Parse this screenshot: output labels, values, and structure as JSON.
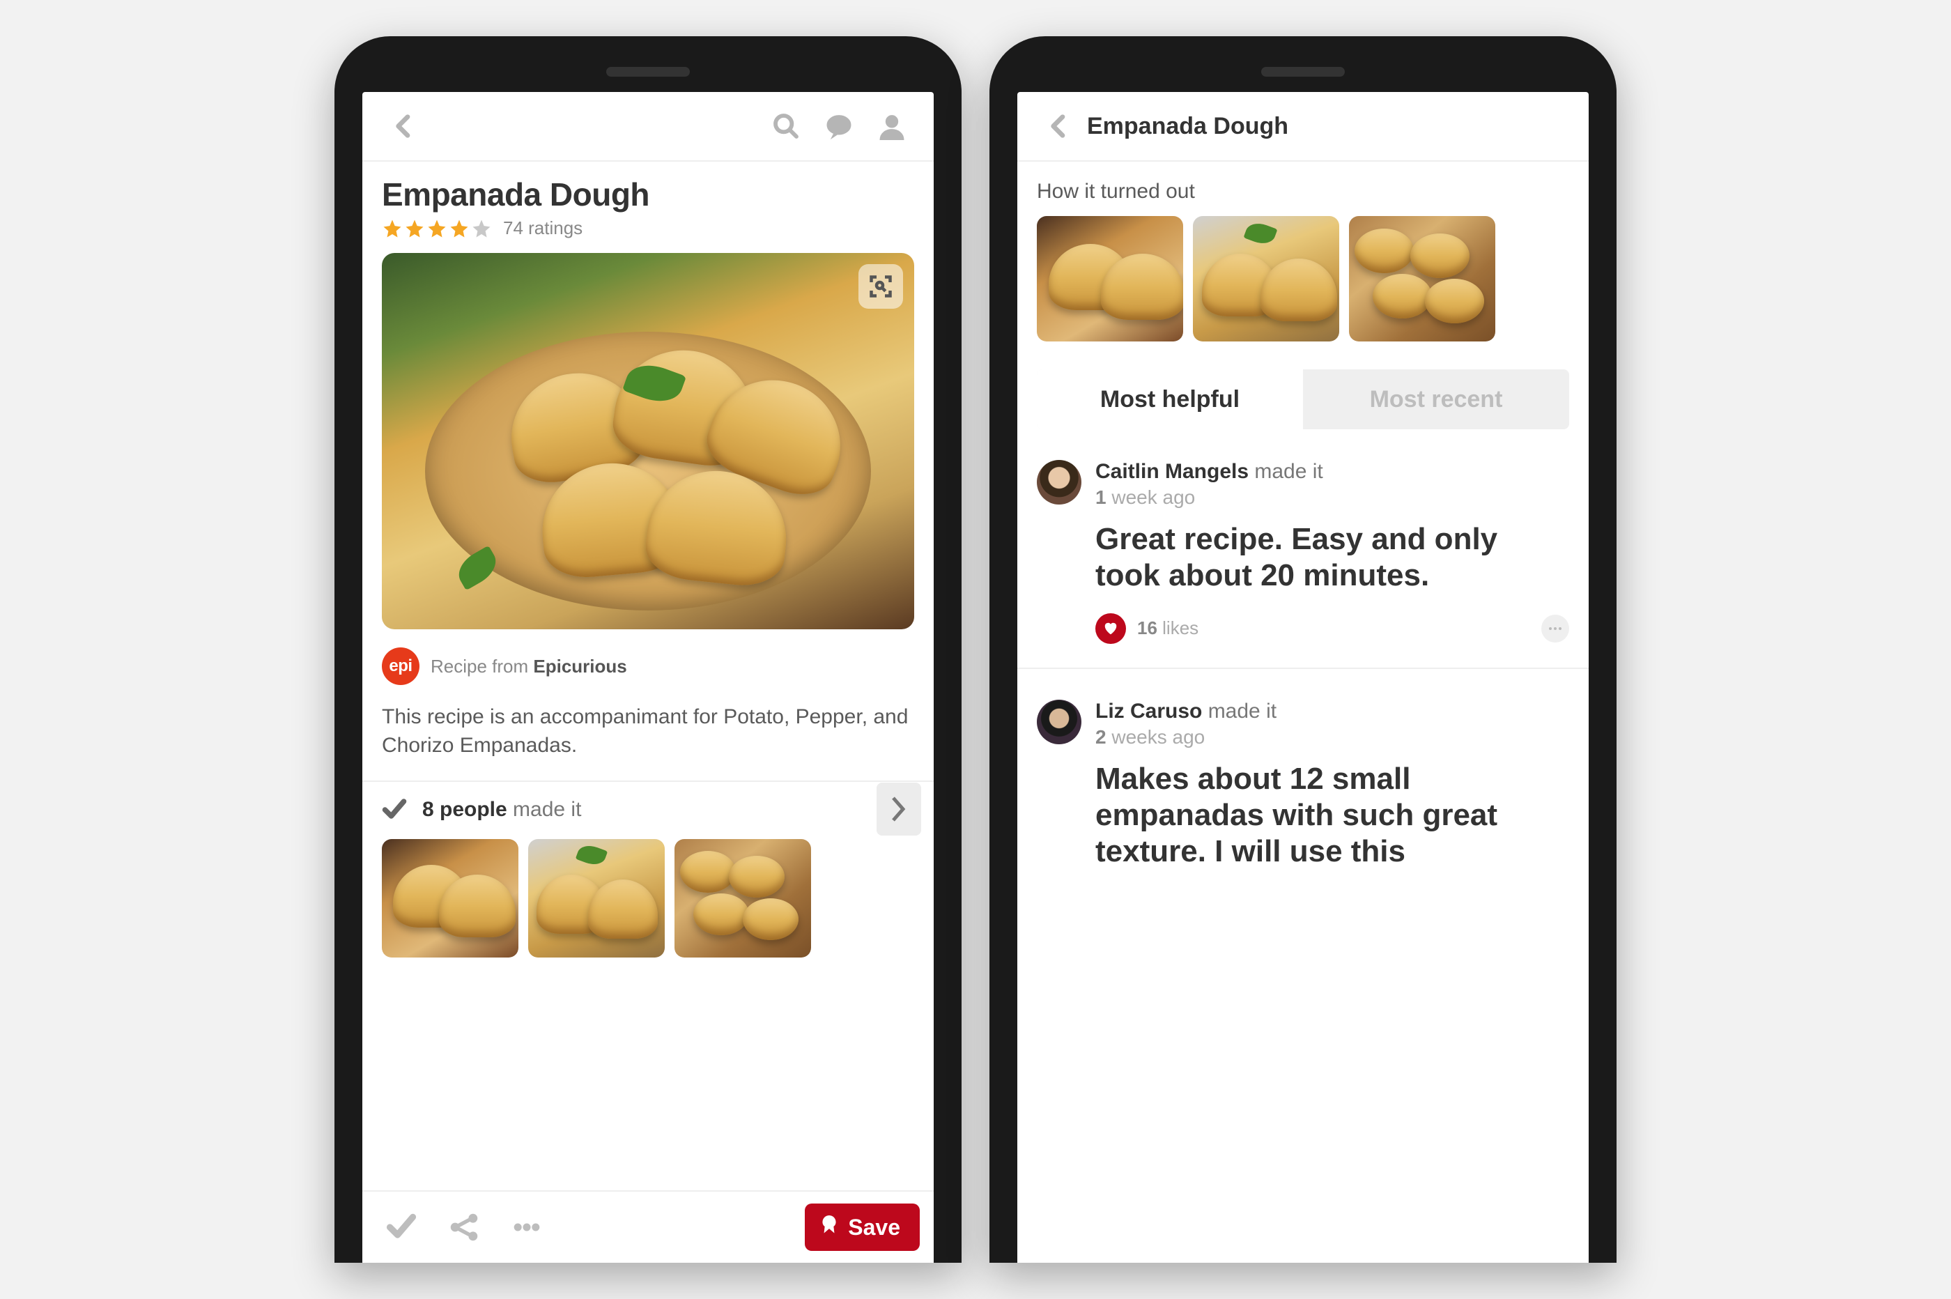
{
  "left": {
    "title": "Empanada Dough",
    "rating": {
      "stars": 4,
      "max": 5,
      "count_text": "74 ratings"
    },
    "source": {
      "badge": "epi",
      "prefix": "Recipe from ",
      "name": "Epicurious"
    },
    "description": "This recipe is an accompanimant for Potato, Pepper, and Chorizo Empanadas.",
    "made_it": {
      "count_bold": "8 people",
      "suffix": " made it"
    },
    "bottom": {
      "save_label": "Save"
    }
  },
  "right": {
    "header_title": "Empanada Dough",
    "section_label": "How it turned out",
    "tabs": {
      "helpful": "Most helpful",
      "recent": "Most recent"
    },
    "reviews": [
      {
        "name": "Caitlin Mangels",
        "suffix": " made it",
        "time_bold": "1",
        "time_rest": " week ago",
        "body": "Great recipe. Easy and only took about 20 minutes.",
        "likes_bold": "16",
        "likes_rest": " likes"
      },
      {
        "name": "Liz Caruso",
        "suffix": " made it",
        "time_bold": "2",
        "time_rest": " weeks ago",
        "body": "Makes about 12 small empanadas with such great texture. I will use this"
      }
    ]
  }
}
